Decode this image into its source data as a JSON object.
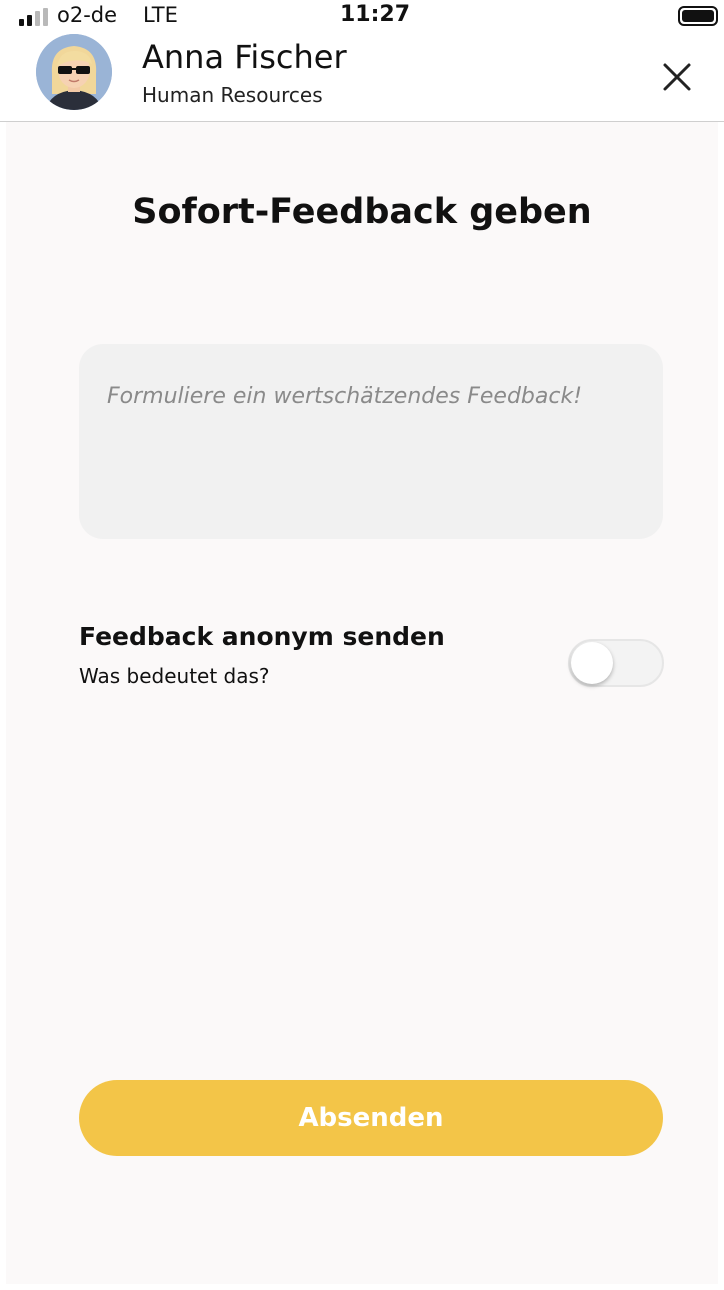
{
  "status_bar": {
    "carrier": "o2-de",
    "network": "LTE",
    "time": "11:27",
    "signal_bars_active": 2,
    "signal_bars_total": 4,
    "battery_level": 1.0
  },
  "header": {
    "user_name": "Anna Fischer",
    "department": "Human Resources",
    "avatar_icon": "user-avatar",
    "close_icon": "close-icon"
  },
  "main": {
    "title": "Sofort-Feedback geben",
    "feedback": {
      "placeholder": "Formuliere ein wertschätzendes Feedback!",
      "value": ""
    },
    "anonymous": {
      "label": "Feedback anonym senden",
      "help_link": "Was bedeutet das?",
      "enabled": false
    },
    "submit_label": "Absenden"
  },
  "colors": {
    "accent": "#f3c548",
    "background": "#fbf9f9",
    "input_background": "#f1f1f1",
    "avatar_background": "#9ab4d6"
  }
}
